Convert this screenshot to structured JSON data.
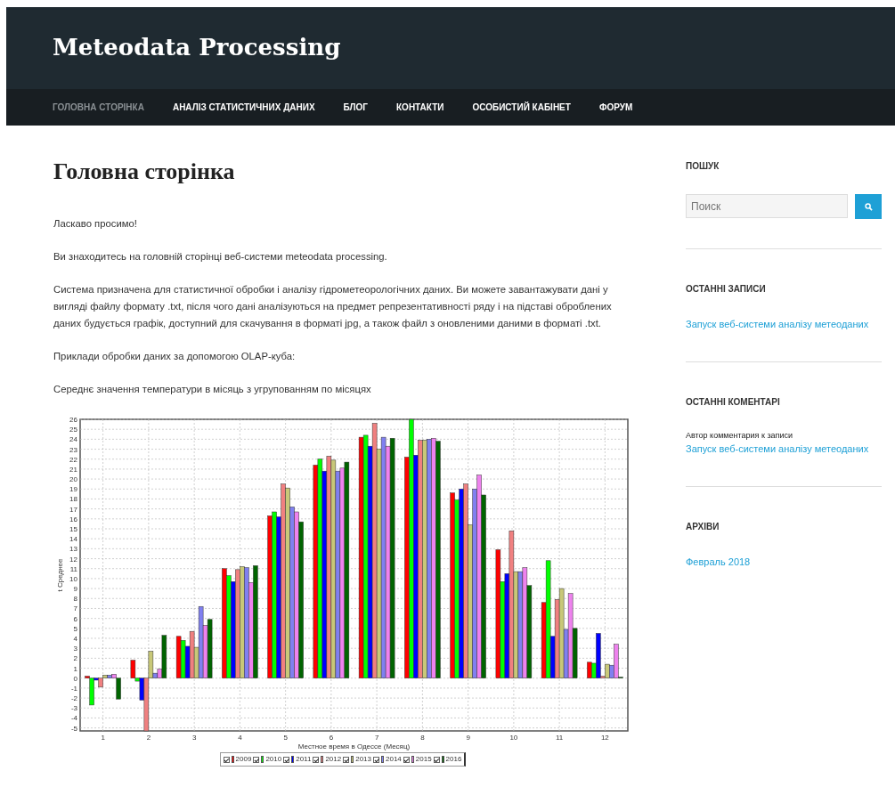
{
  "site_title": "Meteodata Processing",
  "nav": [
    {
      "label": "ГОЛОВНА СТОРІНКА",
      "selected": true
    },
    {
      "label": "АНАЛІЗ СТАТИСТИЧНИХ ДАНИХ",
      "selected": false
    },
    {
      "label": "БЛОГ",
      "selected": false
    },
    {
      "label": "КОНТАКТИ",
      "selected": false
    },
    {
      "label": "ОСОБИСТИЙ КАБІНЕТ",
      "selected": false
    },
    {
      "label": "ФОРУМ",
      "selected": false
    }
  ],
  "page_title": "Головна сторінка",
  "paragraphs": [
    "Ласкаво просимо!",
    "Ви знаходитесь на головній сторінці веб-системи meteodata processing.",
    "Система призначена для статистичної обробки і аналізу гідрометеорологічних даних. Ви можете завантажувати дані у вигляді файлу формату .txt, після чого дані аналізуються на предмет репрезентативності ряду і на підставі оброблених даних будується графік, доступний для скачування в форматі jpg, а також файл з оновленими даними в форматі .txt.",
    "Приклади обробки даних за допомогою OLAP-куба:",
    "Середнє значення температури в місяць з угрупованням по місяцях"
  ],
  "legend_checkboxes": [
    {
      "checked": true
    },
    {
      "checked": true
    },
    {
      "checked": true
    },
    {
      "checked": true
    },
    {
      "checked": true
    },
    {
      "checked": true
    },
    {
      "checked": true
    },
    {
      "checked": true
    }
  ],
  "chart_data": {
    "type": "bar",
    "grid": true,
    "legend": true,
    "xlabel": "Местное время в Одессе (Месяц)",
    "ylabel": "t Среднее",
    "categories": [
      "1",
      "2",
      "3",
      "4",
      "5",
      "6",
      "7",
      "8",
      "9",
      "10",
      "11",
      "12"
    ],
    "ylim": [
      -5.3,
      26
    ],
    "yticks": [
      -5,
      -4,
      -3,
      -2,
      -1,
      0,
      1,
      2,
      3,
      4,
      5,
      6,
      7,
      8,
      9,
      10,
      11,
      12,
      13,
      14,
      15,
      16,
      17,
      18,
      19,
      20,
      21,
      22,
      23,
      24,
      25,
      26
    ],
    "series": [
      {
        "name": "2009",
        "color": "#ff0000",
        "values": [
          0.2,
          1.8,
          4.2,
          11.0,
          16.3,
          21.4,
          24.2,
          22.2,
          18.6,
          12.9,
          7.6,
          1.6
        ]
      },
      {
        "name": "2010",
        "color": "#00ff00",
        "values": [
          -2.7,
          -0.3,
          3.8,
          10.3,
          16.7,
          22.0,
          24.4,
          26.0,
          17.9,
          9.7,
          11.8,
          1.5
        ]
      },
      {
        "name": "2011",
        "color": "#0000ff",
        "values": [
          -0.2,
          -2.2,
          3.2,
          9.7,
          16.2,
          20.8,
          23.3,
          22.4,
          19.0,
          10.5,
          4.2,
          4.5
        ]
      },
      {
        "name": "2012",
        "color": "#f08080",
        "values": [
          -0.9,
          -5.3,
          4.7,
          10.9,
          19.5,
          22.3,
          25.6,
          23.9,
          19.5,
          14.8,
          7.9,
          0.2
        ]
      },
      {
        "name": "2013",
        "color": "#c8c878",
        "values": [
          0.3,
          2.7,
          3.1,
          11.2,
          19.1,
          21.9,
          23.0,
          23.9,
          15.4,
          10.7,
          9.0,
          1.4
        ]
      },
      {
        "name": "2014",
        "color": "#8080f0",
        "values": [
          0.3,
          0.5,
          7.2,
          11.1,
          17.2,
          20.8,
          24.2,
          24.0,
          19.0,
          10.7,
          4.9,
          1.3
        ]
      },
      {
        "name": "2015",
        "color": "#ee82ee",
        "values": [
          0.4,
          0.9,
          5.3,
          9.6,
          16.7,
          21.1,
          23.3,
          24.1,
          20.4,
          11.1,
          8.5,
          3.4
        ]
      },
      {
        "name": "2016",
        "color": "#006400",
        "values": [
          -2.1,
          4.3,
          5.9,
          11.3,
          15.7,
          21.7,
          24.1,
          23.8,
          18.4,
          9.3,
          5.0,
          0.1
        ]
      }
    ]
  },
  "sidebar": {
    "search": {
      "heading": "ПОШУК",
      "placeholder": "Поиск"
    },
    "recent_posts": {
      "heading": "ОСТАННІ ЗАПИСИ",
      "links": [
        "Запуск веб-системи аналізу метеоданих"
      ]
    },
    "recent_comments": {
      "heading": "ОСТАННІ КОМЕНТАРІ",
      "items": [
        {
          "author": "Автор комментария к записи",
          "link": "Запуск веб-системи аналізу метеоданих"
        }
      ]
    },
    "archives": {
      "heading": "АРХІВИ",
      "links": [
        "Февраль 2018"
      ]
    }
  }
}
